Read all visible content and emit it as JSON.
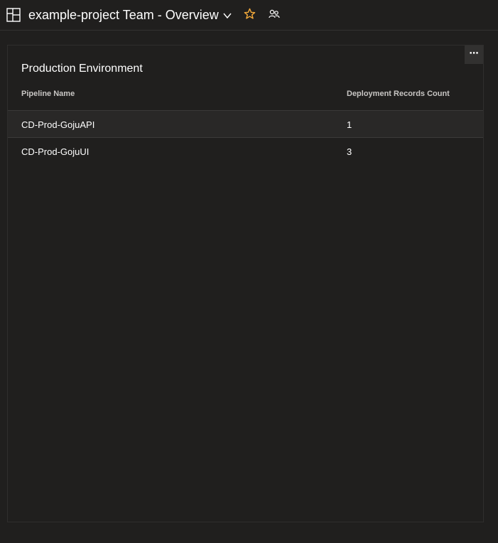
{
  "header": {
    "title": "example-project Team - Overview"
  },
  "widget": {
    "title": "Production Environment",
    "more_label": "⋯",
    "columns": [
      "Pipeline Name",
      "Deployment Records Count"
    ],
    "rows": [
      {
        "name": "CD-Prod-GojuAPI",
        "count": "1"
      },
      {
        "name": "CD-Prod-GojuUI",
        "count": "3"
      }
    ]
  },
  "colors": {
    "background": "#201f1e",
    "accent_star": "#f2a93b",
    "selected_row": "#292827"
  },
  "icons": [
    "dashboard-icon",
    "chevron-down-icon",
    "star-icon",
    "team-icon",
    "more-options-icon"
  ]
}
